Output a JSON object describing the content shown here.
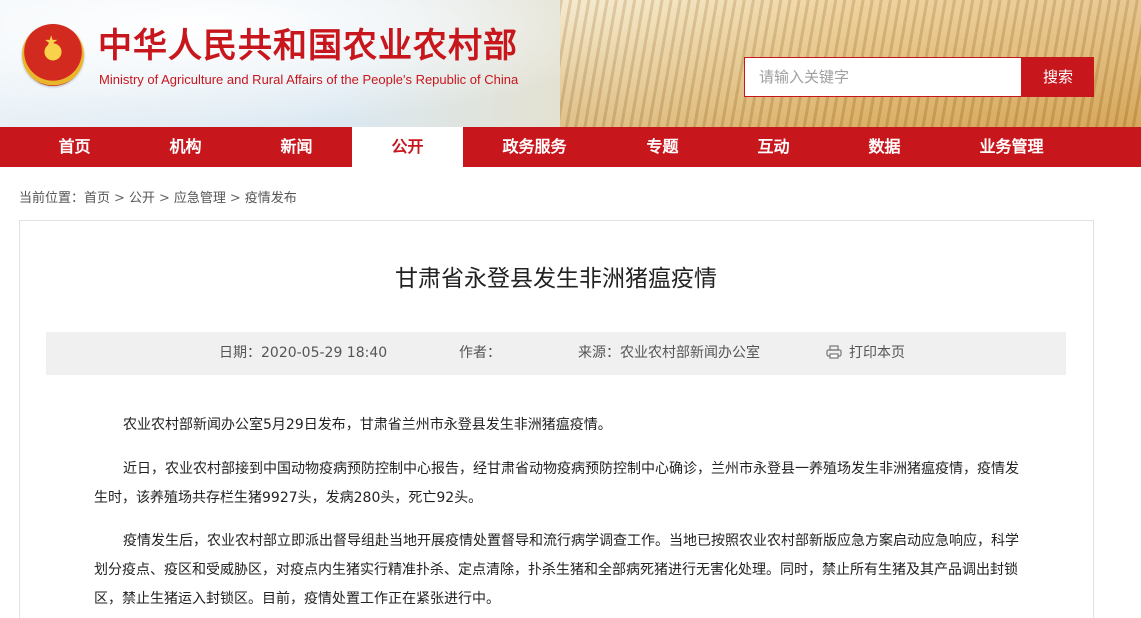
{
  "header": {
    "title": "中华人民共和国农业农村部",
    "subtitle": "Ministry of Agriculture and Rural Affairs of the People's Republic of China",
    "emblem_icon": "national-emblem-icon",
    "search": {
      "placeholder": "请输入关键字",
      "button_label": "搜索"
    },
    "accent_color": "#c8161d"
  },
  "nav": {
    "items": [
      {
        "label": "首页"
      },
      {
        "label": "机构"
      },
      {
        "label": "新闻"
      },
      {
        "label": "公开",
        "active": true
      },
      {
        "label": "政务服务"
      },
      {
        "label": "专题"
      },
      {
        "label": "互动"
      },
      {
        "label": "数据"
      },
      {
        "label": "业务管理"
      }
    ]
  },
  "breadcrumb": {
    "prefix": "当前位置：",
    "items": [
      "首页",
      "公开",
      "应急管理",
      "疫情发布"
    ],
    "separator": ">"
  },
  "article": {
    "title": "甘肃省永登县发生非洲猪瘟疫情",
    "date_label": "日期：",
    "date": "2020-05-29 18:40",
    "author_label": "作者：",
    "author": "",
    "source_label": "来源：",
    "source": "农业农村部新闻办公室",
    "print_label": "打印本页",
    "print_icon": "printer-icon",
    "paragraphs": [
      "农业农村部新闻办公室5月29日发布，甘肃省兰州市永登县发生非洲猪瘟疫情。",
      "近日，农业农村部接到中国动物疫病预防控制中心报告，经甘肃省动物疫病预防控制中心确诊，兰州市永登县一养殖场发生非洲猪瘟疫情，疫情发生时，该养殖场共存栏生猪9927头，发病280头，死亡92头。",
      "疫情发生后，农业农村部立即派出督导组赴当地开展疫情处置督导和流行病学调查工作。当地已按照农业农村部新版应急方案启动应急响应，科学划分疫点、疫区和受威胁区，对疫点内生猪实行精准扑杀、定点清除，扑杀生猪和全部病死猪进行无害化处理。同时，禁止所有生猪及其产品调出封锁区，禁止生猪运入封锁区。目前，疫情处置工作正在紧张进行中。"
    ]
  }
}
